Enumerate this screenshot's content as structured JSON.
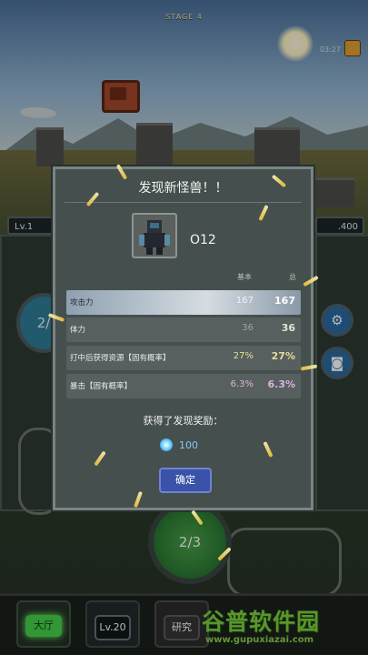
{
  "hud": {
    "stage": "STAGE 4",
    "timer": "03:27",
    "level_left": "Lv.1",
    "gold_right": ".400",
    "gauge_left": "2/",
    "wave_gauge": "2/3"
  },
  "dialog": {
    "title": "发现新怪兽！！",
    "monster_name": "O12",
    "col_base": "基本",
    "col_total": "总",
    "stats": [
      {
        "label": "攻击力",
        "base": "167",
        "total": "167"
      },
      {
        "label": "体力",
        "base": "36",
        "total": "36"
      },
      {
        "label": "打中后获得资源【固有概率】",
        "base": "27%",
        "total": "27%"
      },
      {
        "label": "暴击【固有概率】",
        "base": "6.3%",
        "total": "6.3%"
      }
    ],
    "reward_title": "获得了发现奖励：",
    "reward_value": "100",
    "confirm_label": "确定"
  },
  "bottom_nav": {
    "hall": "大厅",
    "level": "Lv.20",
    "research": "研究"
  },
  "watermark": {
    "main": "谷普软件园",
    "url": "www.gupuxiazai.com"
  },
  "colors": {
    "dialog_bg": "#454f4d",
    "highlight_row": "#d5dde2",
    "confirm_button": "#3a52a8",
    "hall_tab": "#46d14a"
  }
}
